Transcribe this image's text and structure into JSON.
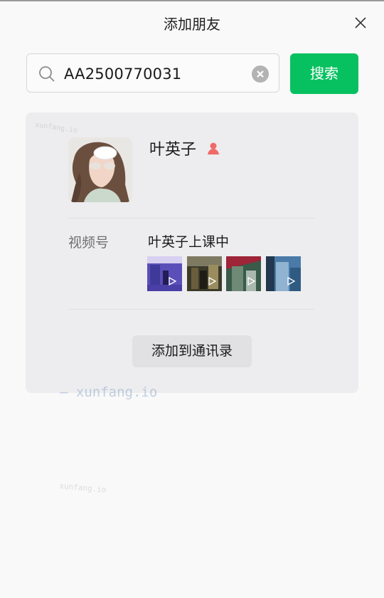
{
  "window": {
    "title": "添加朋友"
  },
  "search": {
    "value": "AA2500770031",
    "button_label": "搜索"
  },
  "result": {
    "name": "叶英子",
    "gender": "female",
    "channels_label": "视频号",
    "channels_name": "叶英子上课中",
    "thumbnail_count": 4,
    "add_button_label": "添加到通讯录"
  },
  "watermarks": [
    "xunfang.io",
    "— xunfang.io",
    "xunfang.io"
  ],
  "colors": {
    "accent": "#07c160",
    "card": "#ededef",
    "gender_female": "#f06a6a"
  }
}
